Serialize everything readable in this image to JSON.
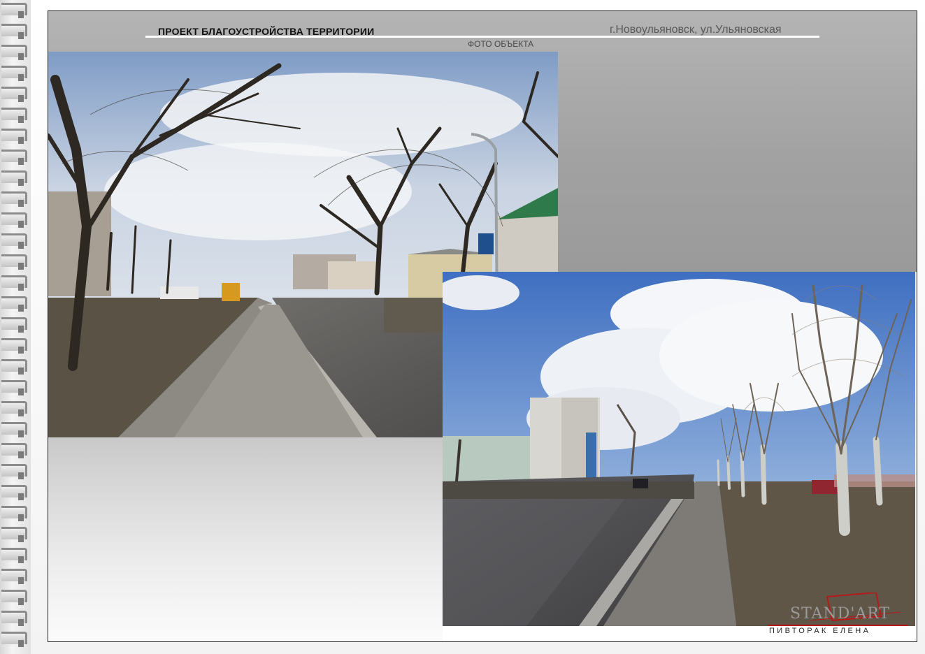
{
  "header": {
    "title": "ПРОЕКТ БЛАГОУСТРОЙСТВА ТЕРРИТОРИИ",
    "address": "г.Новоульяновск, ул.Ульяновская",
    "caption": "ФОТО ОБЪЕКТА"
  },
  "photos": [
    {
      "subject": "street-with-bare-trees-and-sidewalk"
    },
    {
      "subject": "street-with-poplar-alley-and-clouds"
    }
  ],
  "logo": {
    "word": "STAND'ART",
    "author": "ПИВТОРАК ЕЛЕНА",
    "accent_color": "#b51919"
  },
  "colors": {
    "band": "#a8a8a8",
    "frame": "#222222"
  }
}
